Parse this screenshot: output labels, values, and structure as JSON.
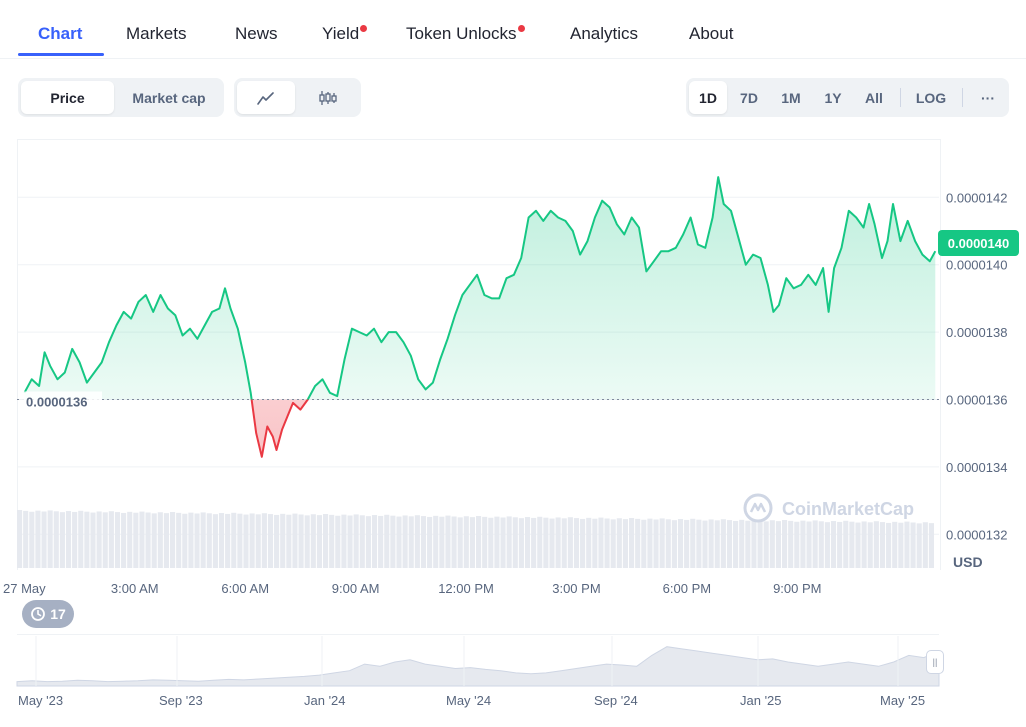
{
  "tabs": [
    {
      "label": "Chart",
      "active": true,
      "dot": false
    },
    {
      "label": "Markets",
      "active": false,
      "dot": false
    },
    {
      "label": "News",
      "active": false,
      "dot": false
    },
    {
      "label": "Yield",
      "active": false,
      "dot": true
    },
    {
      "label": "Token Unlocks",
      "active": false,
      "dot": true
    },
    {
      "label": "Analytics",
      "active": false,
      "dot": false
    },
    {
      "label": "About",
      "active": false,
      "dot": false
    }
  ],
  "toolbar": {
    "metric_options": [
      "Price",
      "Market cap"
    ],
    "metric_selected": "Price",
    "chart_type_icons": [
      "line-chart-icon",
      "candlestick-icon"
    ],
    "chart_type_selected": "line-chart-icon",
    "ranges": [
      "1D",
      "7D",
      "1M",
      "1Y",
      "All"
    ],
    "range_selected": "1D",
    "log_label": "LOG",
    "more_label": "···"
  },
  "chart_data": {
    "type": "area",
    "title": "",
    "currency_label": "USD",
    "current_price_label": "0.0000140",
    "baseline_label": "0.0000136",
    "baseline_value": 1.36e-05,
    "watermark": "CoinMarketCap",
    "y_ticks": [
      "0.0000142",
      "0.0000140",
      "0.0000138",
      "0.0000136",
      "0.0000134",
      "0.0000132"
    ],
    "y_tick_values": [
      1.42e-05,
      1.4e-05,
      1.38e-05,
      1.36e-05,
      1.34e-05,
      1.32e-05
    ],
    "ylim": [
      1.31e-05,
      1.437e-05
    ],
    "x_ticks": [
      "27 May",
      "3:00 AM",
      "6:00 AM",
      "9:00 AM",
      "12:00 PM",
      "3:00 PM",
      "6:00 PM",
      "9:00 PM"
    ],
    "x_tick_hours": [
      0,
      3,
      6,
      9,
      12,
      15,
      18,
      21
    ],
    "xlim_hours": [
      -0.2,
      24.85
    ],
    "colors": {
      "up": "#16c784",
      "down": "#ea3943"
    },
    "series": [
      {
        "values": [
          [
            0.0,
            1.362e-05
          ],
          [
            0.2,
            1.366e-05
          ],
          [
            0.4,
            1.364e-05
          ],
          [
            0.55,
            1.374e-05
          ],
          [
            0.7,
            1.37e-05
          ],
          [
            0.9,
            1.366e-05
          ],
          [
            1.1,
            1.368e-05
          ],
          [
            1.3,
            1.375e-05
          ],
          [
            1.5,
            1.371e-05
          ],
          [
            1.7,
            1.365e-05
          ],
          [
            1.9,
            1.368e-05
          ],
          [
            2.1,
            1.371e-05
          ],
          [
            2.3,
            1.377e-05
          ],
          [
            2.5,
            1.382e-05
          ],
          [
            2.7,
            1.386e-05
          ],
          [
            2.9,
            1.384e-05
          ],
          [
            3.1,
            1.389e-05
          ],
          [
            3.3,
            1.391e-05
          ],
          [
            3.5,
            1.386e-05
          ],
          [
            3.7,
            1.391e-05
          ],
          [
            3.9,
            1.387e-05
          ],
          [
            4.1,
            1.385e-05
          ],
          [
            4.3,
            1.379e-05
          ],
          [
            4.5,
            1.381e-05
          ],
          [
            4.7,
            1.378e-05
          ],
          [
            4.9,
            1.382e-05
          ],
          [
            5.1,
            1.386e-05
          ],
          [
            5.3,
            1.387e-05
          ],
          [
            5.45,
            1.393e-05
          ],
          [
            5.6,
            1.387e-05
          ],
          [
            5.8,
            1.381e-05
          ],
          [
            6.0,
            1.371e-05
          ],
          [
            6.15,
            1.362e-05
          ],
          [
            6.3,
            1.35e-05
          ],
          [
            6.45,
            1.343e-05
          ],
          [
            6.6,
            1.352e-05
          ],
          [
            6.75,
            1.349e-05
          ],
          [
            6.85,
            1.345e-05
          ],
          [
            7.0,
            1.351e-05
          ],
          [
            7.15,
            1.355e-05
          ],
          [
            7.3,
            1.359e-05
          ],
          [
            7.5,
            1.357e-05
          ],
          [
            7.7,
            1.36e-05
          ],
          [
            7.9,
            1.364e-05
          ],
          [
            8.1,
            1.366e-05
          ],
          [
            8.3,
            1.362e-05
          ],
          [
            8.5,
            1.361e-05
          ],
          [
            8.7,
            1.372e-05
          ],
          [
            8.9,
            1.381e-05
          ],
          [
            9.1,
            1.38e-05
          ],
          [
            9.3,
            1.379e-05
          ],
          [
            9.5,
            1.381e-05
          ],
          [
            9.7,
            1.377e-05
          ],
          [
            9.9,
            1.38e-05
          ],
          [
            10.1,
            1.38e-05
          ],
          [
            10.3,
            1.377e-05
          ],
          [
            10.5,
            1.373e-05
          ],
          [
            10.7,
            1.366e-05
          ],
          [
            10.9,
            1.363e-05
          ],
          [
            11.1,
            1.365e-05
          ],
          [
            11.3,
            1.372e-05
          ],
          [
            11.5,
            1.378e-05
          ],
          [
            11.7,
            1.385e-05
          ],
          [
            11.9,
            1.391e-05
          ],
          [
            12.1,
            1.394e-05
          ],
          [
            12.3,
            1.397e-05
          ],
          [
            12.5,
            1.391e-05
          ],
          [
            12.7,
            1.39e-05
          ],
          [
            12.9,
            1.39e-05
          ],
          [
            13.1,
            1.396e-05
          ],
          [
            13.3,
            1.397e-05
          ],
          [
            13.5,
            1.402e-05
          ],
          [
            13.7,
            1.414e-05
          ],
          [
            13.9,
            1.416e-05
          ],
          [
            14.1,
            1.413e-05
          ],
          [
            14.3,
            1.416e-05
          ],
          [
            14.5,
            1.414e-05
          ],
          [
            14.7,
            1.413e-05
          ],
          [
            14.9,
            1.41e-05
          ],
          [
            15.1,
            1.403e-05
          ],
          [
            15.3,
            1.407e-05
          ],
          [
            15.5,
            1.414e-05
          ],
          [
            15.7,
            1.419e-05
          ],
          [
            15.9,
            1.417e-05
          ],
          [
            16.1,
            1.412e-05
          ],
          [
            16.3,
            1.409e-05
          ],
          [
            16.5,
            1.414e-05
          ],
          [
            16.7,
            1.411e-05
          ],
          [
            16.9,
            1.398e-05
          ],
          [
            17.1,
            1.401e-05
          ],
          [
            17.3,
            1.404e-05
          ],
          [
            17.5,
            1.404e-05
          ],
          [
            17.7,
            1.405e-05
          ],
          [
            17.9,
            1.409e-05
          ],
          [
            18.1,
            1.414e-05
          ],
          [
            18.3,
            1.406e-05
          ],
          [
            18.5,
            1.405e-05
          ],
          [
            18.7,
            1.414e-05
          ],
          [
            18.85,
            1.426e-05
          ],
          [
            19.0,
            1.418e-05
          ],
          [
            19.2,
            1.416e-05
          ],
          [
            19.4,
            1.408e-05
          ],
          [
            19.6,
            1.4e-05
          ],
          [
            19.8,
            1.403e-05
          ],
          [
            20.0,
            1.402e-05
          ],
          [
            20.2,
            1.394e-05
          ],
          [
            20.35,
            1.386e-05
          ],
          [
            20.5,
            1.388e-05
          ],
          [
            20.7,
            1.396e-05
          ],
          [
            20.9,
            1.393e-05
          ],
          [
            21.1,
            1.394e-05
          ],
          [
            21.3,
            1.397e-05
          ],
          [
            21.5,
            1.394e-05
          ],
          [
            21.7,
            1.399e-05
          ],
          [
            21.85,
            1.386e-05
          ],
          [
            22.0,
            1.399e-05
          ],
          [
            22.2,
            1.405e-05
          ],
          [
            22.4,
            1.416e-05
          ],
          [
            22.6,
            1.414e-05
          ],
          [
            22.8,
            1.411e-05
          ],
          [
            22.95,
            1.418e-05
          ],
          [
            23.1,
            1.412e-05
          ],
          [
            23.3,
            1.402e-05
          ],
          [
            23.45,
            1.407e-05
          ],
          [
            23.6,
            1.418e-05
          ],
          [
            23.8,
            1.407e-05
          ],
          [
            24.0,
            1.413e-05
          ],
          [
            24.2,
            1.407e-05
          ],
          [
            24.4,
            1.403e-05
          ],
          [
            24.6,
            1.401e-05
          ],
          [
            24.75,
            1.404e-05
          ]
        ]
      }
    ],
    "volume_bars_count": 150,
    "navigator": {
      "labels": [
        "May '23",
        "Sep '23",
        "Jan '24",
        "May '24",
        "Sep '24",
        "Jan '25",
        "May '25"
      ],
      "values": [
        0.1,
        0.12,
        0.1,
        0.11,
        0.13,
        0.12,
        0.1,
        0.11,
        0.12,
        0.14,
        0.13,
        0.12,
        0.11,
        0.13,
        0.15,
        0.14,
        0.16,
        0.18,
        0.2,
        0.22,
        0.25,
        0.3,
        0.35,
        0.5,
        0.45,
        0.55,
        0.6,
        0.5,
        0.45,
        0.4,
        0.42,
        0.38,
        0.35,
        0.3,
        0.28,
        0.3,
        0.35,
        0.4,
        0.45,
        0.5,
        0.48,
        0.45,
        0.7,
        0.9,
        0.85,
        0.8,
        0.75,
        0.7,
        0.65,
        0.6,
        0.62,
        0.55,
        0.5,
        0.45,
        0.5,
        0.55,
        0.5,
        0.45,
        0.55,
        0.7,
        0.65,
        0.8
      ]
    }
  },
  "history_count": "17"
}
